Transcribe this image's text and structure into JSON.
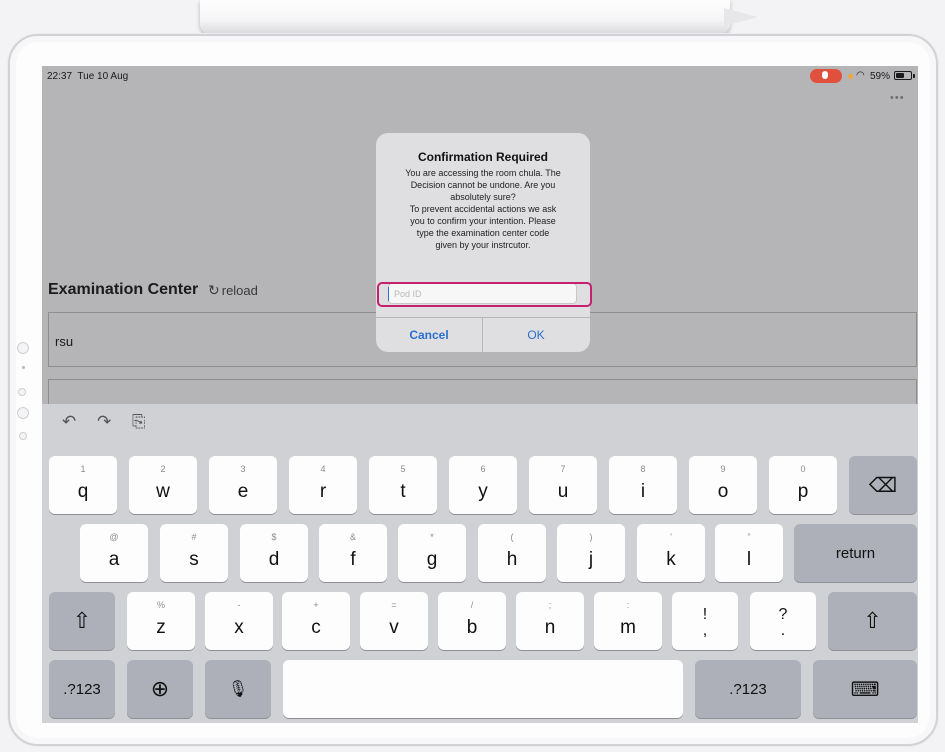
{
  "status": {
    "time": "22:37",
    "date": "Tue 10 Aug",
    "battery_text": "59%",
    "battery_level": 0.59
  },
  "app": {
    "more_icon": "ellipsis-icon"
  },
  "page": {
    "section_title": "Examination Center",
    "reload_label": "reload",
    "rows": [
      "rsu"
    ]
  },
  "alert": {
    "title": "Confirmation Required",
    "message_lines": [
      "You are accessing the room chula. The",
      "Decision cannot be undone. Are you",
      "absolutely sure?",
      "To prevent accidental actions we ask",
      "you to confirm your intention. Please",
      "type the examination center code",
      "given  by your instrcutor."
    ],
    "input_placeholder": "Pod ID",
    "input_value": "",
    "cancel_label": "Cancel",
    "ok_label": "OK"
  },
  "keyboard": {
    "row1": [
      {
        "hint": "1",
        "label": "q"
      },
      {
        "hint": "2",
        "label": "w"
      },
      {
        "hint": "3",
        "label": "e"
      },
      {
        "hint": "4",
        "label": "r"
      },
      {
        "hint": "5",
        "label": "t"
      },
      {
        "hint": "6",
        "label": "y"
      },
      {
        "hint": "7",
        "label": "u"
      },
      {
        "hint": "8",
        "label": "i"
      },
      {
        "hint": "9",
        "label": "o"
      },
      {
        "hint": "0",
        "label": "p"
      }
    ],
    "row2": [
      {
        "hint": "@",
        "label": "a"
      },
      {
        "hint": "#",
        "label": "s"
      },
      {
        "hint": "$",
        "label": "d"
      },
      {
        "hint": "&",
        "label": "f"
      },
      {
        "hint": "*",
        "label": "g"
      },
      {
        "hint": "(",
        "label": "h"
      },
      {
        "hint": ")",
        "label": "j"
      },
      {
        "hint": "’",
        "label": "k"
      },
      {
        "hint": "”",
        "label": "l"
      }
    ],
    "row3": [
      {
        "hint": "%",
        "label": "z"
      },
      {
        "hint": "-",
        "label": "x"
      },
      {
        "hint": "+",
        "label": "c"
      },
      {
        "hint": "=",
        "label": "v"
      },
      {
        "hint": "/",
        "label": "b"
      },
      {
        "hint": ";",
        "label": "n"
      },
      {
        "hint": ":",
        "label": "m"
      }
    ],
    "punct1": {
      "top": "!",
      "bottom": ","
    },
    "punct2": {
      "top": "?",
      "bottom": "."
    },
    "return_label": "return",
    "numbers_label": ".?123",
    "delete_icon": "delete-backward-icon",
    "shift_icon": "shift-icon",
    "globe_icon": "globe-icon",
    "mic_icon": "microphone-icon",
    "dismiss_icon": "keyboard-dismiss-icon"
  }
}
